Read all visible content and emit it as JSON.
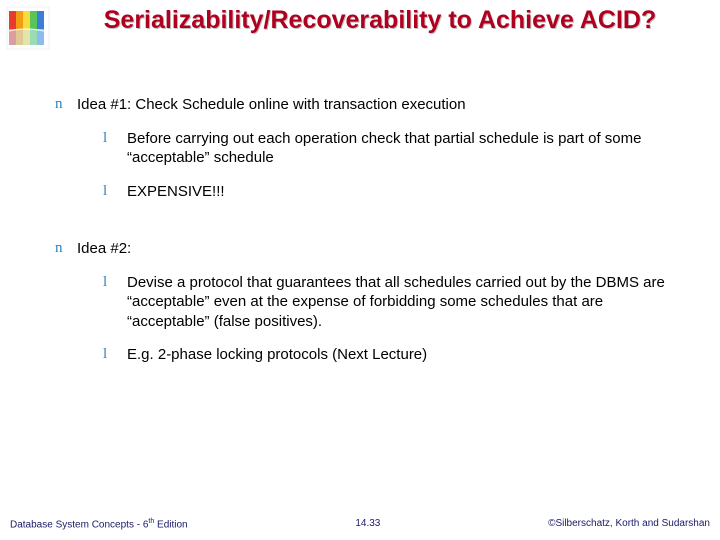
{
  "title": "Serializability/Recoverability  to Achieve ACID?",
  "ideas": [
    {
      "heading": "Idea #1: Check Schedule online with transaction execution",
      "points": [
        "Before carrying out each operation check that partial schedule is part of some “acceptable” schedule",
        "EXPENSIVE!!!"
      ]
    },
    {
      "heading": "Idea #2:",
      "points": [
        "Devise a protocol that guarantees that all schedules carried out by the DBMS are “acceptable” even at the expense of forbidding some schedules that are “acceptable” (false positives).",
        "E.g. 2-phase locking protocols (Next Lecture)"
      ]
    }
  ],
  "footer": {
    "left_prefix": "Database System Concepts - 6",
    "left_sup": "th",
    "left_suffix": " Edition",
    "center": "14.33",
    "right": "©Silberschatz, Korth and Sudarshan"
  },
  "bullets": {
    "n": "n",
    "l": "l"
  }
}
